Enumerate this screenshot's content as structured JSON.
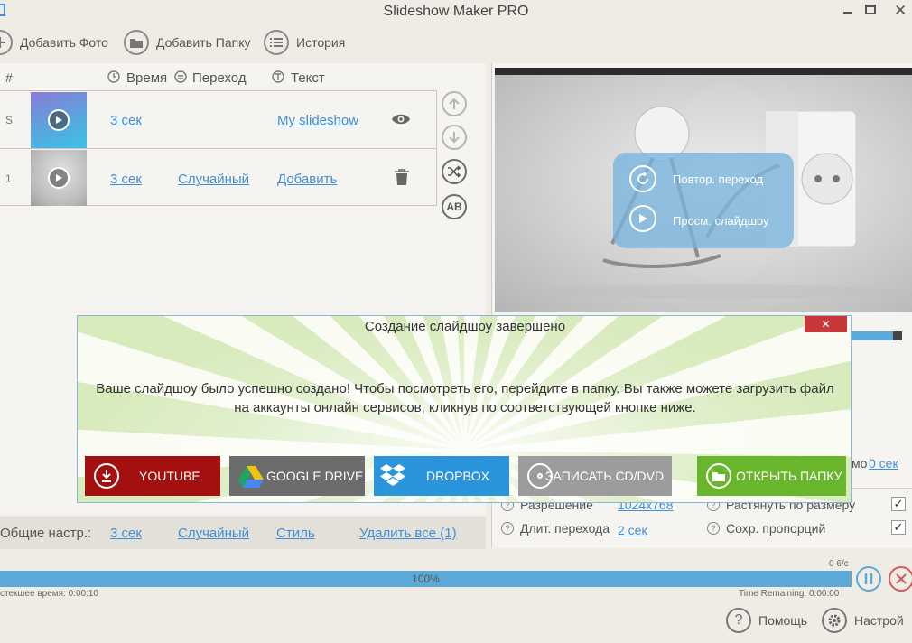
{
  "window": {
    "title": "Slideshow Maker PRO"
  },
  "toolbar": {
    "add_photo": "Добавить Фото",
    "add_folder": "Добавить Папку",
    "history": "История"
  },
  "table": {
    "headers": {
      "num": "#",
      "time": "Время",
      "transition": "Переход",
      "text": "Текст"
    },
    "rows": [
      {
        "num": "S",
        "time": "3 сек",
        "transition": "",
        "text": "My slideshow"
      },
      {
        "num": "1",
        "time": "3 сек",
        "transition": "Случайный",
        "text": "Добавить"
      }
    ]
  },
  "preview_overlay": {
    "repeat_transition": "Повтор. переход",
    "view_slideshow": "Просм. слайдшоу"
  },
  "general_settings": {
    "label": "Общие настр.:",
    "time": "3 сек",
    "transition": "Случайный",
    "style": "Стиль",
    "delete_all": "Удалить все (1)"
  },
  "settings": {
    "partial_label": "мо",
    "partial_value": "0 сек",
    "resolution_label": "Разрешение",
    "resolution_value": "1024x768",
    "transition_duration_label": "Длит. перехода",
    "transition_duration_value": "2 сек",
    "stretch_label": "Растянуть по размеру",
    "keep_proportions_label": "Сохр. пропорций"
  },
  "progress": {
    "percent_text": "100%",
    "percent_value": 100,
    "count": "0 6/с",
    "elapsed": "стекшее время: 0:00:10",
    "remaining": "Time Remaining: 0:00:00"
  },
  "footer": {
    "help": "Помощь",
    "settings": "Настрой"
  },
  "dialog": {
    "title": "Создание слайдшоу завершено",
    "message_line1": "Ваше слайдшоу было успешно создано! Чтобы посмотреть его, перейдите в папку. Вы также можете загрузить файл",
    "message_line2": "на аккаунты онлайн сервисов, кликнув по соответствующей кнопке ниже.",
    "close": "✕",
    "buttons": {
      "youtube": "YOUTUBE",
      "google_drive": "GOOGLE DRIVE",
      "dropbox": "DROPBOX",
      "burn_cd": "ЗАПИСАТЬ CD/DVD",
      "open_folder": "ОТКРЫТЬ ПАПКУ"
    }
  },
  "colors": {
    "accent": "#3f8fd8",
    "youtube": "#a3100f",
    "google_drive": "#6c6c6c",
    "dropbox": "#2b95dc",
    "burn_cd": "#9c9c9c",
    "open_folder": "#69b52c",
    "close": "#c8383a"
  }
}
